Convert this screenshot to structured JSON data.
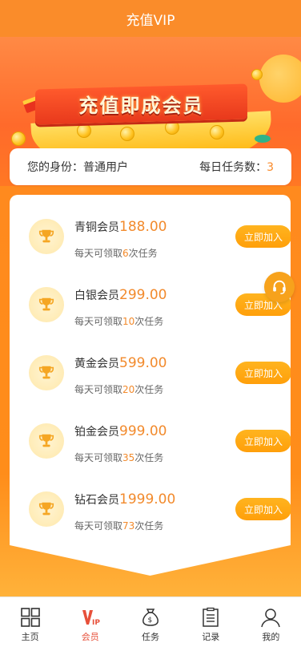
{
  "header": {
    "title": "充值VIP"
  },
  "banner": {
    "title": "充值即成会员"
  },
  "identity": {
    "label": "您的身份：普通用户",
    "task_label": "每日任务数：",
    "task_count": "3"
  },
  "levels": [
    {
      "name": "青铜会员",
      "price": "188.00",
      "sub_prefix": "每天可领取",
      "tasks": "6",
      "sub_suffix": "次任务",
      "button": "立即加入"
    },
    {
      "name": "白银会员",
      "price": "299.00",
      "sub_prefix": "每天可领取",
      "tasks": "10",
      "sub_suffix": "次任务",
      "button": "立即加入"
    },
    {
      "name": "黄金会员",
      "price": "599.00",
      "sub_prefix": "每天可领取",
      "tasks": "20",
      "sub_suffix": "次任务",
      "button": "立即加入"
    },
    {
      "name": "铂金会员",
      "price": "999.00",
      "sub_prefix": "每天可领取",
      "tasks": "35",
      "sub_suffix": "次任务",
      "button": "立即加入"
    },
    {
      "name": "钻石会员",
      "price": "1999.00",
      "sub_prefix": "每天可领取",
      "tasks": "73",
      "sub_suffix": "次任务",
      "button": "立即加入"
    }
  ],
  "tabbar": {
    "items": [
      {
        "label": "主页",
        "icon": "grid-icon"
      },
      {
        "label": "会员",
        "icon": "vip-icon",
        "active": true
      },
      {
        "label": "任务",
        "icon": "money-bag-icon"
      },
      {
        "label": "记录",
        "icon": "clipboard-icon"
      },
      {
        "label": "我的",
        "icon": "user-icon"
      }
    ]
  },
  "colors": {
    "accent": "#fa8c2a",
    "price": "#f28a2c",
    "button": "#ffa915",
    "active_tab": "#e7503a"
  }
}
